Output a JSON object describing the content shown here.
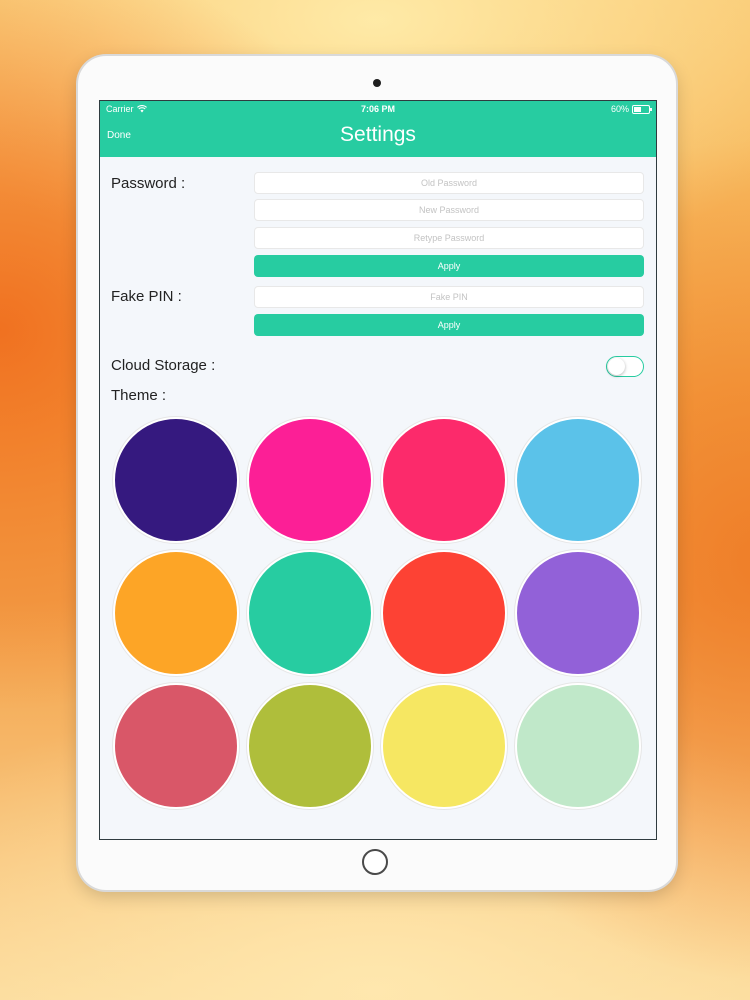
{
  "status_bar": {
    "carrier": "Carrier",
    "time": "7:06 PM",
    "battery": "60%",
    "battery_fraction": 0.6
  },
  "nav": {
    "done_label": "Done",
    "title": "Settings"
  },
  "password": {
    "label": "Password :",
    "old_placeholder": "Old Password",
    "new_placeholder": "New Password",
    "retype_placeholder": "Retype Password",
    "apply_label": "Apply"
  },
  "fake_pin": {
    "label": "Fake PIN :",
    "placeholder": "Fake PIN",
    "apply_label": "Apply"
  },
  "cloud_storage": {
    "label": "Cloud Storage :",
    "enabled": false
  },
  "theme": {
    "label": "Theme :",
    "colors": [
      "#35197f",
      "#fc1f96",
      "#fc2a6b",
      "#5bc2e9",
      "#fda526",
      "#27cca1",
      "#fd4234",
      "#9261d8",
      "#d95768",
      "#afbe3b",
      "#f6e762",
      "#c0e8c9"
    ]
  },
  "colors": {
    "accent": "#27cca1"
  }
}
